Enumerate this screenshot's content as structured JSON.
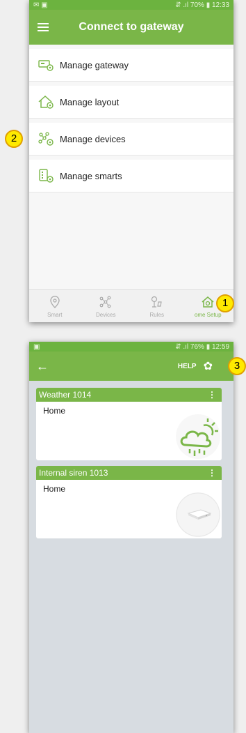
{
  "screen1": {
    "status_left": "✉ ▣",
    "status_right": "⇵ .ıl 70% ▮ 12:33",
    "title": "Connect to gateway",
    "menu": [
      {
        "label": "Manage gateway",
        "icon": "gateway-icon"
      },
      {
        "label": "Manage layout",
        "icon": "layout-icon"
      },
      {
        "label": "Manage devices",
        "icon": "devices-icon"
      },
      {
        "label": "Manage smarts",
        "icon": "smarts-icon"
      }
    ],
    "nav": [
      {
        "label": "Smart",
        "icon": "smart-icon"
      },
      {
        "label": "Devices",
        "icon": "devices-icon"
      },
      {
        "label": "Rules",
        "icon": "rules-icon"
      },
      {
        "label": "ome Setup",
        "icon": "home-setup-icon"
      }
    ],
    "active_color": "#7ab648"
  },
  "screen2": {
    "status_left": "▣",
    "status_right": "⇵ .ıl 76% ▮ 12:59",
    "help": "HELP",
    "cards": [
      {
        "title": "Weather 1014",
        "body": "Home",
        "icon": "weather-icon"
      },
      {
        "title": "Internal siren 1013",
        "body": "Home",
        "icon": "siren-icon"
      }
    ]
  },
  "badges": {
    "one": "1",
    "two": "2",
    "three": "3"
  }
}
